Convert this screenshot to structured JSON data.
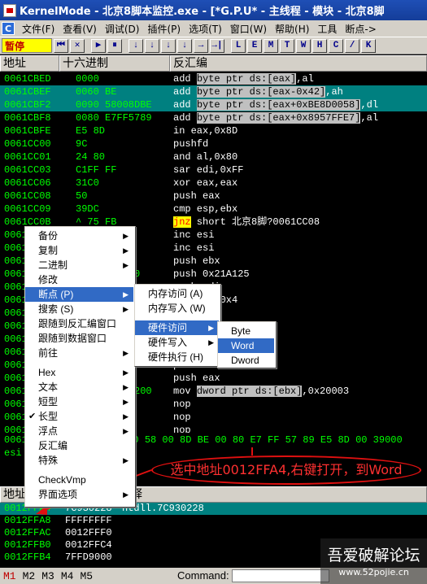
{
  "window": {
    "title": "KernelMode - 北京8脚本监控.exe - [*G.P.U* - 主线程 - 模块 - 北京8脚"
  },
  "menu": {
    "items": [
      "文件(F)",
      "查看(V)",
      "调试(D)",
      "插件(P)",
      "选项(T)",
      "窗口(W)",
      "帮助(H)",
      "工具",
      "断点->"
    ]
  },
  "toolbar": {
    "status": "暂停",
    "buttons1": [
      "⏮",
      "✕",
      "▶",
      "⏸",
      "↓",
      "↓",
      "↓",
      "↓",
      "→",
      "→|"
    ],
    "buttons2": [
      "L",
      "E",
      "M",
      "T",
      "W",
      "H",
      "C",
      "/",
      "K",
      "B",
      "R",
      "...",
      "S",
      "≡",
      "?"
    ]
  },
  "cpu": {
    "col_address": "地址",
    "col_hex": "十六进制",
    "col_disasm": "反汇编",
    "rows": [
      {
        "addr": "0061CBED",
        "hex": "0000",
        "dis_pre": "add ",
        "dis_hl": "byte ptr ds:[eax]",
        "dis_post": ",al",
        "sel": false
      },
      {
        "addr": "0061CBEF",
        "hex": "0060 BE",
        "dis_pre": "add ",
        "dis_hl": "byte ptr ds:[eax-0x42]",
        "dis_post": ",ah",
        "sel": true
      },
      {
        "addr": "0061CBF2",
        "hex": "0090 58008DBE",
        "dis_pre": "add ",
        "dis_hl": "byte ptr ds:[eax+0xBE8D0058]",
        "dis_post": ",dl",
        "sel": true
      },
      {
        "addr": "0061CBF8",
        "hex": "0080 E7FF5789",
        "dis_pre": "add ",
        "dis_hl": "byte ptr ds:[eax+0x8957FFE7]",
        "dis_post": ",al",
        "sel": false
      },
      {
        "addr": "0061CBFE",
        "hex": "E5 8D",
        "dis_pre": "in eax,0x8D",
        "dis_hl": "",
        "dis_post": "",
        "sel": false
      },
      {
        "addr": "0061CC00",
        "hex": "9C",
        "dis_pre": "pushfd",
        "dis_hl": "",
        "dis_post": "",
        "sel": false
      },
      {
        "addr": "0061CC01",
        "hex": "24 80",
        "dis_pre": "and al,0x80",
        "dis_hl": "",
        "dis_post": "",
        "sel": false
      },
      {
        "addr": "0061CC03",
        "hex": "C1FF FF",
        "dis_pre": "sar edi,0xFF",
        "dis_hl": "",
        "dis_post": "",
        "sel": false
      },
      {
        "addr": "0061CC06",
        "hex": "31C0",
        "dis_pre": "xor eax,eax",
        "dis_hl": "",
        "dis_post": "",
        "sel": false
      },
      {
        "addr": "0061CC08",
        "hex": "50",
        "dis_pre": "push eax",
        "dis_hl": "",
        "dis_post": "",
        "sel": false
      },
      {
        "addr": "0061CC09",
        "hex": "39DC",
        "dis_pre": "cmp esp,ebx",
        "dis_hl": "",
        "dis_post": "",
        "sel": false
      },
      {
        "addr": "0061CC0B",
        "hex": "^ 75 FB",
        "dis_jnz": "jnz",
        "dis_pre": " short 北京8脚?0061CC08",
        "dis_hl": "",
        "dis_post": "",
        "sel": false
      },
      {
        "addr": "0061CC0D",
        "hex": "46",
        "dis_pre": "inc esi",
        "dis_hl": "",
        "dis_post": "",
        "sel": false
      },
      {
        "addr": "0061CC0E",
        "hex": "46",
        "dis_pre": "inc esi",
        "dis_hl": "",
        "dis_post": "",
        "sel": false
      },
      {
        "addr": "0061CC0F",
        "hex": "53",
        "dis_pre": "push ebx",
        "dis_hl": "",
        "dis_post": "",
        "sel": false
      },
      {
        "addr": "0061CC10",
        "hex": "68 25A12100",
        "dis_pre": "push 0x21A125",
        "dis_hl": "",
        "dis_post": "",
        "sel": false
      },
      {
        "addr": "0061CC15",
        "hex": "57",
        "dis_pre": "push edi",
        "dis_hl": "",
        "dis_post": "",
        "sel": false
      },
      {
        "addr": "0061CC16",
        "hex": "83C3 04",
        "dis_pre": "add ebx,0x4",
        "dis_hl": "",
        "dis_post": "",
        "sel": false
      },
      {
        "addr": "0061CC19",
        "hex": "53",
        "dis_pre": "push ebx",
        "dis_hl": "",
        "dis_post": "",
        "sel": false
      },
      {
        "addr": "0061CC1A",
        "hex": "68",
        "dis_pre": "push",
        "dis_hl": "",
        "dis_post": "",
        "sel": false
      },
      {
        "addr": "0061CC1B",
        "hex": "56",
        "dis_pre": "push esi",
        "dis_hl": "",
        "dis_post": "",
        "sel": false
      },
      {
        "addr": "0061CC1C",
        "hex": "83C3",
        "dis_pre": "add",
        "dis_hl": "",
        "dis_post": "",
        "sel": false
      },
      {
        "addr": "0061CC1F",
        "hex": "53",
        "dis_pre": "push ebx",
        "dis_hl": "",
        "dis_post": "",
        "sel": false
      },
      {
        "addr": "0061CC20",
        "hex": "50",
        "dis_pre": "push eax",
        "dis_hl": "",
        "dis_post": "",
        "sel": false
      },
      {
        "addr": "0061CC21",
        "hex": "C703 02000200",
        "dis_pre": "mov ",
        "dis_hl": "dword ptr ds:[ebx]",
        "dis_post": ",0x20003",
        "sel": false
      },
      {
        "addr": "0061CC27",
        "hex": "90",
        "dis_pre": "nop",
        "dis_hl": "",
        "dis_post": "",
        "sel": false
      },
      {
        "addr": "0061CC28",
        "hex": "90",
        "dis_pre": "nop",
        "dis_hl": "",
        "dis_post": "",
        "sel": false
      },
      {
        "addr": "0061CC29",
        "hex": "90",
        "dis_pre": "nop",
        "dis_hl": "",
        "dis_post": "",
        "sel": false
      }
    ]
  },
  "regs": {
    "line1": "0061CBEF  00 60 BE 00 90 58 00 8D BE 00 80 E7 FF 57 89 E5 8D  00 39000",
    "line2": "esi"
  },
  "dump": {
    "col_address": "地址",
    "col_value": "",
    "col_comment": "注释"
  },
  "stack": {
    "rows": [
      {
        "addr": "0012FFA4",
        "val": "7C930228",
        "comment": "ntdll.7C930228",
        "sel": true
      },
      {
        "addr": "0012FFA8",
        "val": "FFFFFFFF",
        "comment": "",
        "sel": false
      },
      {
        "addr": "0012FFAC",
        "val": "0012FFF0",
        "comment": "",
        "sel": false
      },
      {
        "addr": "0012FFB0",
        "val": "0012FFC4",
        "comment": "",
        "sel": false
      },
      {
        "addr": "0012FFB4",
        "val": "7FFD9000",
        "comment": "",
        "sel": false
      }
    ]
  },
  "cmdbar": {
    "tabs": [
      "M1",
      "M2",
      "M3",
      "M4",
      "M5"
    ],
    "label": "Command:"
  },
  "watermark": {
    "text": "吾爱破解论坛",
    "url": "www.52pojie.cn"
  },
  "annotation": {
    "text": "选中地址0012FFA4,右键打开，到Word"
  },
  "context_menu": {
    "items": [
      {
        "label": "备份",
        "arrow": true
      },
      {
        "label": "复制",
        "arrow": true
      },
      {
        "label": "二进制",
        "arrow": true
      },
      {
        "label": "修改",
        "arrow": false
      },
      {
        "label": "断点 (P)",
        "arrow": true,
        "active": true
      },
      {
        "label": "搜索 (S)",
        "arrow": true
      },
      {
        "label": "跟随到反汇编窗口",
        "arrow": false
      },
      {
        "label": "跟随到数据窗口",
        "arrow": false
      },
      {
        "label": "前往",
        "arrow": true
      },
      {
        "label": "Hex",
        "arrow": true
      },
      {
        "label": "文本",
        "arrow": true
      },
      {
        "label": "短型",
        "arrow": true
      },
      {
        "label": "长型",
        "arrow": true,
        "check": true
      },
      {
        "label": "浮点",
        "arrow": true
      },
      {
        "label": "反汇编",
        "arrow": false
      },
      {
        "label": "特殊",
        "arrow": true
      },
      {
        "label": "CheckVmp",
        "arrow": false
      },
      {
        "label": "界面选项",
        "arrow": true
      }
    ]
  },
  "submenu_breakpoint": {
    "items": [
      "内存访问 (A)",
      "内存写入 (W)",
      "硬件访问",
      "硬件写入",
      "硬件执行 (H)"
    ]
  },
  "submenu_hw": {
    "items": [
      "Byte",
      "Word",
      "Dword"
    ]
  }
}
